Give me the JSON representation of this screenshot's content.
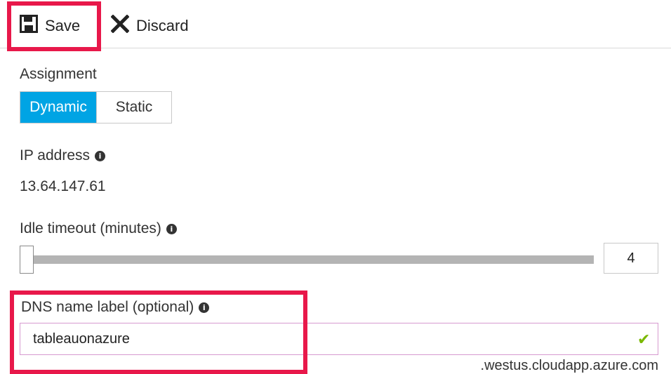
{
  "toolbar": {
    "save_label": "Save",
    "discard_label": "Discard",
    "save_icon": "floppy-disk-icon",
    "discard_icon": "x-icon"
  },
  "assignment": {
    "label": "Assignment",
    "options": [
      "Dynamic",
      "Static"
    ],
    "selected": "Dynamic",
    "accent_color": "#00a4e4"
  },
  "ip_address": {
    "label": "IP address",
    "value": "13.64.147.61"
  },
  "idle_timeout": {
    "label": "Idle timeout (minutes)",
    "value": "4",
    "slider_fraction": 0
  },
  "dns": {
    "label": "DNS name label (optional)",
    "value": "tableauonazure",
    "suffix": ".westus.cloudapp.azure.com",
    "valid_icon": "checkmark-icon",
    "highlight_color": "#e8184a"
  }
}
